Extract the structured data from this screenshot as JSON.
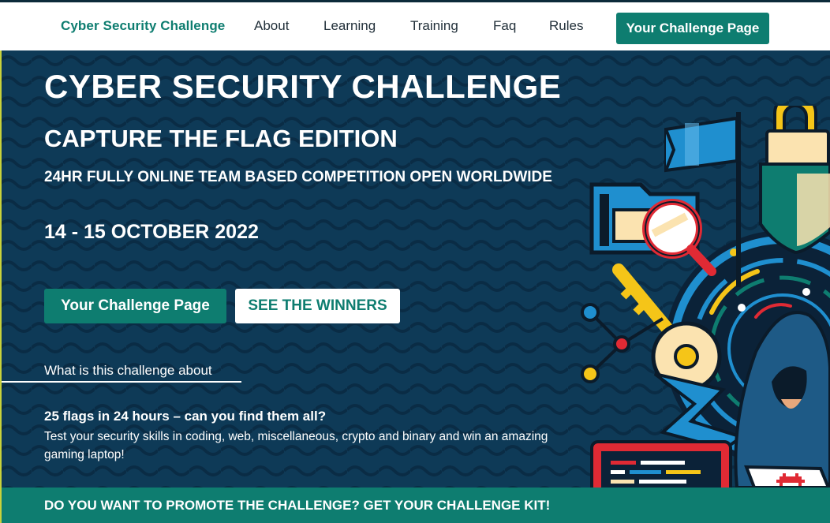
{
  "nav": {
    "brand": "Cyber Security Challenge",
    "links": [
      "About",
      "Learning",
      "Training",
      "Faq",
      "Rules"
    ],
    "cta": "Your Challenge Page"
  },
  "hero": {
    "title": "CYBER SECURITY CHALLENGE",
    "subtitle": "CAPTURE THE FLAG EDITION",
    "tagline": "24HR FULLY ONLINE TEAM BASED COMPETITION OPEN WORLDWIDE",
    "dates": "14 - 15 OCTOBER 2022",
    "primary_button": "Your Challenge Page",
    "secondary_button": "SEE THE WINNERS",
    "about_link": "What is this challenge about",
    "teaser_title": "25 flags in 24 hours – can you find them all?",
    "teaser_text": "Test your security skills in coding, web, miscellaneous, crypto and binary and win an amazing gaming laptop!"
  },
  "promo": {
    "text": "DO YOU WANT TO PROMOTE THE CHALLENGE? GET YOUR CHALLENGE KIT!"
  },
  "colors": {
    "brand_teal": "#0e7d70",
    "hero_navy": "#0e3a57",
    "accent_red": "#e02a34",
    "accent_yellow": "#f5c518",
    "accent_blue": "#1f8fcf"
  },
  "icons": {
    "illustration": "cyber-security-illustration",
    "flag": "flag-icon",
    "lock": "padlock-icon",
    "magnifier": "magnifying-glass-icon",
    "key": "key-icon",
    "hacker": "hooded-hacker-icon",
    "laptop": "laptop-icon",
    "space_invader": "space-invader-icon"
  }
}
